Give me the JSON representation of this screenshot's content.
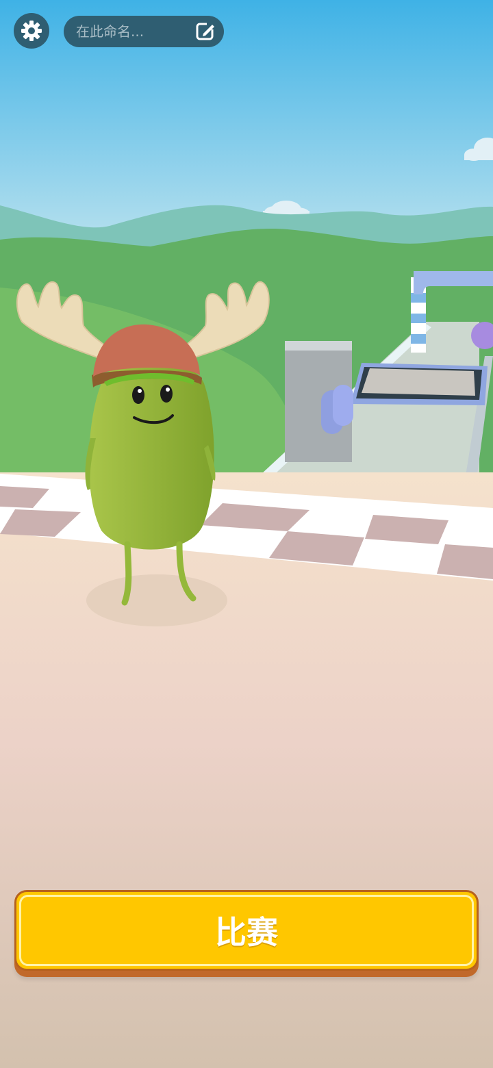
{
  "top_bar": {
    "settings_icon": "gear-icon",
    "name_input": {
      "value": "",
      "placeholder": "在此命名..."
    },
    "edit_icon": "edit-icon"
  },
  "play_button": {
    "label": "比赛"
  },
  "colors": {
    "button_fill": "#ffc700",
    "button_border": "#b6621e",
    "top_controls": "#2f5e72",
    "character_green": "#8fb33a"
  }
}
